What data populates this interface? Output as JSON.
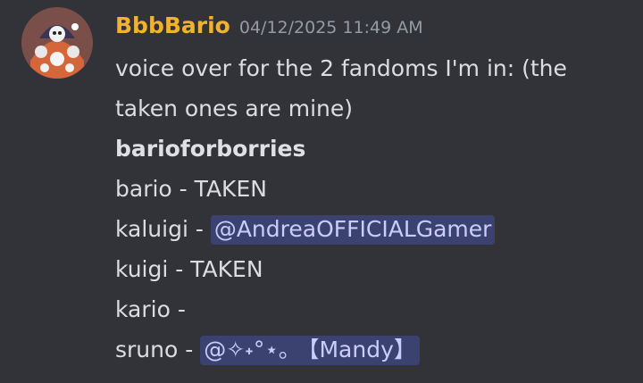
{
  "message": {
    "username": "BbbBario",
    "timestamp": "04/12/2025 11:49 AM",
    "text_line1": "voice over for the 2 fandoms I'm in: (the",
    "text_line2": "taken ones are mine)",
    "heading": "barioforborries",
    "entries": [
      {
        "name": "bario - TAKEN",
        "mention": ""
      },
      {
        "name": "kaluigi - ",
        "mention": "@AndreaOFFICIALGamer"
      },
      {
        "name": "kuigi - TAKEN",
        "mention": ""
      },
      {
        "name": "kario -",
        "mention": ""
      },
      {
        "name": "sruno - ",
        "mention": "@✧˖°⋆｡ 【Mandy】"
      }
    ]
  },
  "colors": {
    "background": "#323339",
    "username": "#f0b232",
    "timestamp": "#949ba4",
    "mention_bg": "#3c4270",
    "mention_text": "#c9cdfb"
  }
}
